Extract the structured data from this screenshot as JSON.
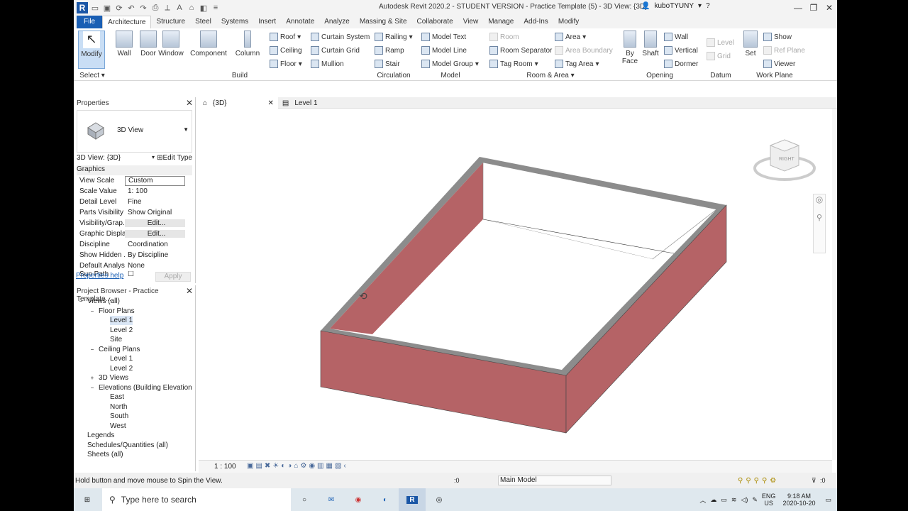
{
  "titlebar": {
    "title": "Autodesk Revit 2020.2 - STUDENT VERSION - Practice Template (5) - 3D View: {3D}",
    "user": "kuboTYUNY",
    "logo": "R"
  },
  "tabs": [
    "File",
    "Architecture",
    "Structure",
    "Steel",
    "Systems",
    "Insert",
    "Annotate",
    "Analyze",
    "Massing & Site",
    "Collaborate",
    "View",
    "Manage",
    "Add-Ins",
    "Modify"
  ],
  "ribbon": {
    "select": {
      "modify": "Modify",
      "label": "Select"
    },
    "build": {
      "label": "Build",
      "wall": "Wall",
      "door": "Door",
      "window": "Window",
      "component": "Component",
      "column": "Column",
      "roof": "Roof",
      "ceiling": "Ceiling",
      "floor": "Floor",
      "curtain_system": "Curtain System",
      "curtain_grid": "Curtain Grid",
      "mullion": "Mullion"
    },
    "circulation": {
      "label": "Circulation",
      "railing": "Railing",
      "ramp": "Ramp",
      "stair": "Stair"
    },
    "model": {
      "label": "Model",
      "model_text": "Model Text",
      "model_line": "Model Line",
      "model_group": "Model Group"
    },
    "room_area": {
      "label": "Room & Area",
      "room": "Room",
      "room_separator": "Room Separator",
      "tag_room": "Tag Room",
      "area": "Area",
      "area_boundary": "Area Boundary",
      "tag_area": "Tag Area"
    },
    "opening": {
      "label": "Opening",
      "by_face_1": "By",
      "by_face_2": "Face",
      "shaft": "Shaft",
      "wall": "Wall",
      "vertical": "Vertical",
      "dormer": "Dormer"
    },
    "datum": {
      "label": "Datum",
      "level": "Level",
      "grid": "Grid"
    },
    "work_plane": {
      "label": "Work Plane",
      "set": "Set",
      "show": "Show",
      "ref_plane": "Ref Plane",
      "viewer": "Viewer"
    }
  },
  "properties": {
    "title": "Properties",
    "type_name": "3D View",
    "view_selector": "3D View: {3D}",
    "edit_type": "Edit Type",
    "group": "Graphics",
    "rows": [
      {
        "k": "View Scale",
        "v": "Custom"
      },
      {
        "k": "Scale Value",
        "v": "1: 100"
      },
      {
        "k": "Detail Level",
        "v": "Fine"
      },
      {
        "k": "Parts Visibility",
        "v": "Show Original"
      },
      {
        "k": "Visibility/Grap...",
        "v": "Edit..."
      },
      {
        "k": "Graphic Displa...",
        "v": "Edit..."
      },
      {
        "k": "Discipline",
        "v": "Coordination"
      },
      {
        "k": "Show Hidden ...",
        "v": "By Discipline"
      },
      {
        "k": "Default Analys...",
        "v": "None"
      },
      {
        "k": "Sun Path",
        "v": ""
      }
    ],
    "help": "Properties help",
    "apply": "Apply"
  },
  "browser": {
    "title": "Project Browser - Practice Template...",
    "nodes": [
      {
        "t": "Views (all)",
        "lvl": 0,
        "tog": "−"
      },
      {
        "t": "Floor Plans",
        "lvl": 1,
        "tog": "−"
      },
      {
        "t": "Level 1",
        "lvl": 2,
        "tog": ""
      },
      {
        "t": "Level 2",
        "lvl": 2,
        "tog": ""
      },
      {
        "t": "Site",
        "lvl": 2,
        "tog": ""
      },
      {
        "t": "Ceiling Plans",
        "lvl": 1,
        "tog": "−"
      },
      {
        "t": "Level 1",
        "lvl": 2,
        "tog": ""
      },
      {
        "t": "Level 2",
        "lvl": 2,
        "tog": ""
      },
      {
        "t": "3D Views",
        "lvl": 1,
        "tog": "+"
      },
      {
        "t": "Elevations (Building Elevation",
        "lvl": 1,
        "tog": "−"
      },
      {
        "t": "East",
        "lvl": 2,
        "tog": ""
      },
      {
        "t": "North",
        "lvl": 2,
        "tog": ""
      },
      {
        "t": "South",
        "lvl": 2,
        "tog": ""
      },
      {
        "t": "West",
        "lvl": 2,
        "tog": ""
      },
      {
        "t": "Legends",
        "lvl": 0,
        "tog": ""
      },
      {
        "t": "Schedules/Quantities (all)",
        "lvl": 0,
        "tog": ""
      },
      {
        "t": "Sheets (all)",
        "lvl": 0,
        "tog": ""
      }
    ]
  },
  "viewtabs": [
    {
      "label": "{3D}"
    },
    {
      "label": "Level 1"
    }
  ],
  "viewcube_label": "RIGHT",
  "view_scale": "1 : 100",
  "status": {
    "hint": "Hold button and move mouse to Spin the View.",
    "workset_count": ":0",
    "model": "Main Model",
    "filter_count": ":0"
  },
  "taskbar": {
    "search": "Type here to search",
    "lang1": "ENG",
    "lang2": "US",
    "time": "9:18 AM",
    "date": "2020-10-20"
  },
  "colors": {
    "wall_face": "#b56366",
    "wall_top": "#8c8c8c",
    "accent": "#1a5fb4"
  }
}
